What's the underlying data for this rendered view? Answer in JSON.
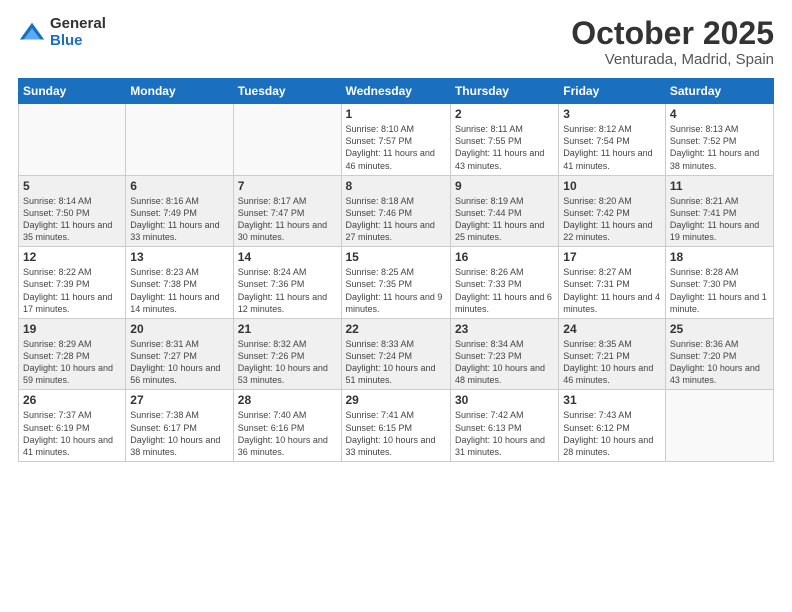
{
  "logo": {
    "general": "General",
    "blue": "Blue"
  },
  "title": {
    "month": "October 2025",
    "location": "Venturada, Madrid, Spain"
  },
  "headers": [
    "Sunday",
    "Monday",
    "Tuesday",
    "Wednesday",
    "Thursday",
    "Friday",
    "Saturday"
  ],
  "weeks": [
    [
      {
        "day": "",
        "sunrise": "",
        "sunset": "",
        "daylight": ""
      },
      {
        "day": "",
        "sunrise": "",
        "sunset": "",
        "daylight": ""
      },
      {
        "day": "",
        "sunrise": "",
        "sunset": "",
        "daylight": ""
      },
      {
        "day": "1",
        "sunrise": "Sunrise: 8:10 AM",
        "sunset": "Sunset: 7:57 PM",
        "daylight": "Daylight: 11 hours and 46 minutes."
      },
      {
        "day": "2",
        "sunrise": "Sunrise: 8:11 AM",
        "sunset": "Sunset: 7:55 PM",
        "daylight": "Daylight: 11 hours and 43 minutes."
      },
      {
        "day": "3",
        "sunrise": "Sunrise: 8:12 AM",
        "sunset": "Sunset: 7:54 PM",
        "daylight": "Daylight: 11 hours and 41 minutes."
      },
      {
        "day": "4",
        "sunrise": "Sunrise: 8:13 AM",
        "sunset": "Sunset: 7:52 PM",
        "daylight": "Daylight: 11 hours and 38 minutes."
      }
    ],
    [
      {
        "day": "5",
        "sunrise": "Sunrise: 8:14 AM",
        "sunset": "Sunset: 7:50 PM",
        "daylight": "Daylight: 11 hours and 35 minutes."
      },
      {
        "day": "6",
        "sunrise": "Sunrise: 8:16 AM",
        "sunset": "Sunset: 7:49 PM",
        "daylight": "Daylight: 11 hours and 33 minutes."
      },
      {
        "day": "7",
        "sunrise": "Sunrise: 8:17 AM",
        "sunset": "Sunset: 7:47 PM",
        "daylight": "Daylight: 11 hours and 30 minutes."
      },
      {
        "day": "8",
        "sunrise": "Sunrise: 8:18 AM",
        "sunset": "Sunset: 7:46 PM",
        "daylight": "Daylight: 11 hours and 27 minutes."
      },
      {
        "day": "9",
        "sunrise": "Sunrise: 8:19 AM",
        "sunset": "Sunset: 7:44 PM",
        "daylight": "Daylight: 11 hours and 25 minutes."
      },
      {
        "day": "10",
        "sunrise": "Sunrise: 8:20 AM",
        "sunset": "Sunset: 7:42 PM",
        "daylight": "Daylight: 11 hours and 22 minutes."
      },
      {
        "day": "11",
        "sunrise": "Sunrise: 8:21 AM",
        "sunset": "Sunset: 7:41 PM",
        "daylight": "Daylight: 11 hours and 19 minutes."
      }
    ],
    [
      {
        "day": "12",
        "sunrise": "Sunrise: 8:22 AM",
        "sunset": "Sunset: 7:39 PM",
        "daylight": "Daylight: 11 hours and 17 minutes."
      },
      {
        "day": "13",
        "sunrise": "Sunrise: 8:23 AM",
        "sunset": "Sunset: 7:38 PM",
        "daylight": "Daylight: 11 hours and 14 minutes."
      },
      {
        "day": "14",
        "sunrise": "Sunrise: 8:24 AM",
        "sunset": "Sunset: 7:36 PM",
        "daylight": "Daylight: 11 hours and 12 minutes."
      },
      {
        "day": "15",
        "sunrise": "Sunrise: 8:25 AM",
        "sunset": "Sunset: 7:35 PM",
        "daylight": "Daylight: 11 hours and 9 minutes."
      },
      {
        "day": "16",
        "sunrise": "Sunrise: 8:26 AM",
        "sunset": "Sunset: 7:33 PM",
        "daylight": "Daylight: 11 hours and 6 minutes."
      },
      {
        "day": "17",
        "sunrise": "Sunrise: 8:27 AM",
        "sunset": "Sunset: 7:31 PM",
        "daylight": "Daylight: 11 hours and 4 minutes."
      },
      {
        "day": "18",
        "sunrise": "Sunrise: 8:28 AM",
        "sunset": "Sunset: 7:30 PM",
        "daylight": "Daylight: 11 hours and 1 minute."
      }
    ],
    [
      {
        "day": "19",
        "sunrise": "Sunrise: 8:29 AM",
        "sunset": "Sunset: 7:28 PM",
        "daylight": "Daylight: 10 hours and 59 minutes."
      },
      {
        "day": "20",
        "sunrise": "Sunrise: 8:31 AM",
        "sunset": "Sunset: 7:27 PM",
        "daylight": "Daylight: 10 hours and 56 minutes."
      },
      {
        "day": "21",
        "sunrise": "Sunrise: 8:32 AM",
        "sunset": "Sunset: 7:26 PM",
        "daylight": "Daylight: 10 hours and 53 minutes."
      },
      {
        "day": "22",
        "sunrise": "Sunrise: 8:33 AM",
        "sunset": "Sunset: 7:24 PM",
        "daylight": "Daylight: 10 hours and 51 minutes."
      },
      {
        "day": "23",
        "sunrise": "Sunrise: 8:34 AM",
        "sunset": "Sunset: 7:23 PM",
        "daylight": "Daylight: 10 hours and 48 minutes."
      },
      {
        "day": "24",
        "sunrise": "Sunrise: 8:35 AM",
        "sunset": "Sunset: 7:21 PM",
        "daylight": "Daylight: 10 hours and 46 minutes."
      },
      {
        "day": "25",
        "sunrise": "Sunrise: 8:36 AM",
        "sunset": "Sunset: 7:20 PM",
        "daylight": "Daylight: 10 hours and 43 minutes."
      }
    ],
    [
      {
        "day": "26",
        "sunrise": "Sunrise: 7:37 AM",
        "sunset": "Sunset: 6:19 PM",
        "daylight": "Daylight: 10 hours and 41 minutes."
      },
      {
        "day": "27",
        "sunrise": "Sunrise: 7:38 AM",
        "sunset": "Sunset: 6:17 PM",
        "daylight": "Daylight: 10 hours and 38 minutes."
      },
      {
        "day": "28",
        "sunrise": "Sunrise: 7:40 AM",
        "sunset": "Sunset: 6:16 PM",
        "daylight": "Daylight: 10 hours and 36 minutes."
      },
      {
        "day": "29",
        "sunrise": "Sunrise: 7:41 AM",
        "sunset": "Sunset: 6:15 PM",
        "daylight": "Daylight: 10 hours and 33 minutes."
      },
      {
        "day": "30",
        "sunrise": "Sunrise: 7:42 AM",
        "sunset": "Sunset: 6:13 PM",
        "daylight": "Daylight: 10 hours and 31 minutes."
      },
      {
        "day": "31",
        "sunrise": "Sunrise: 7:43 AM",
        "sunset": "Sunset: 6:12 PM",
        "daylight": "Daylight: 10 hours and 28 minutes."
      },
      {
        "day": "",
        "sunrise": "",
        "sunset": "",
        "daylight": ""
      }
    ]
  ]
}
